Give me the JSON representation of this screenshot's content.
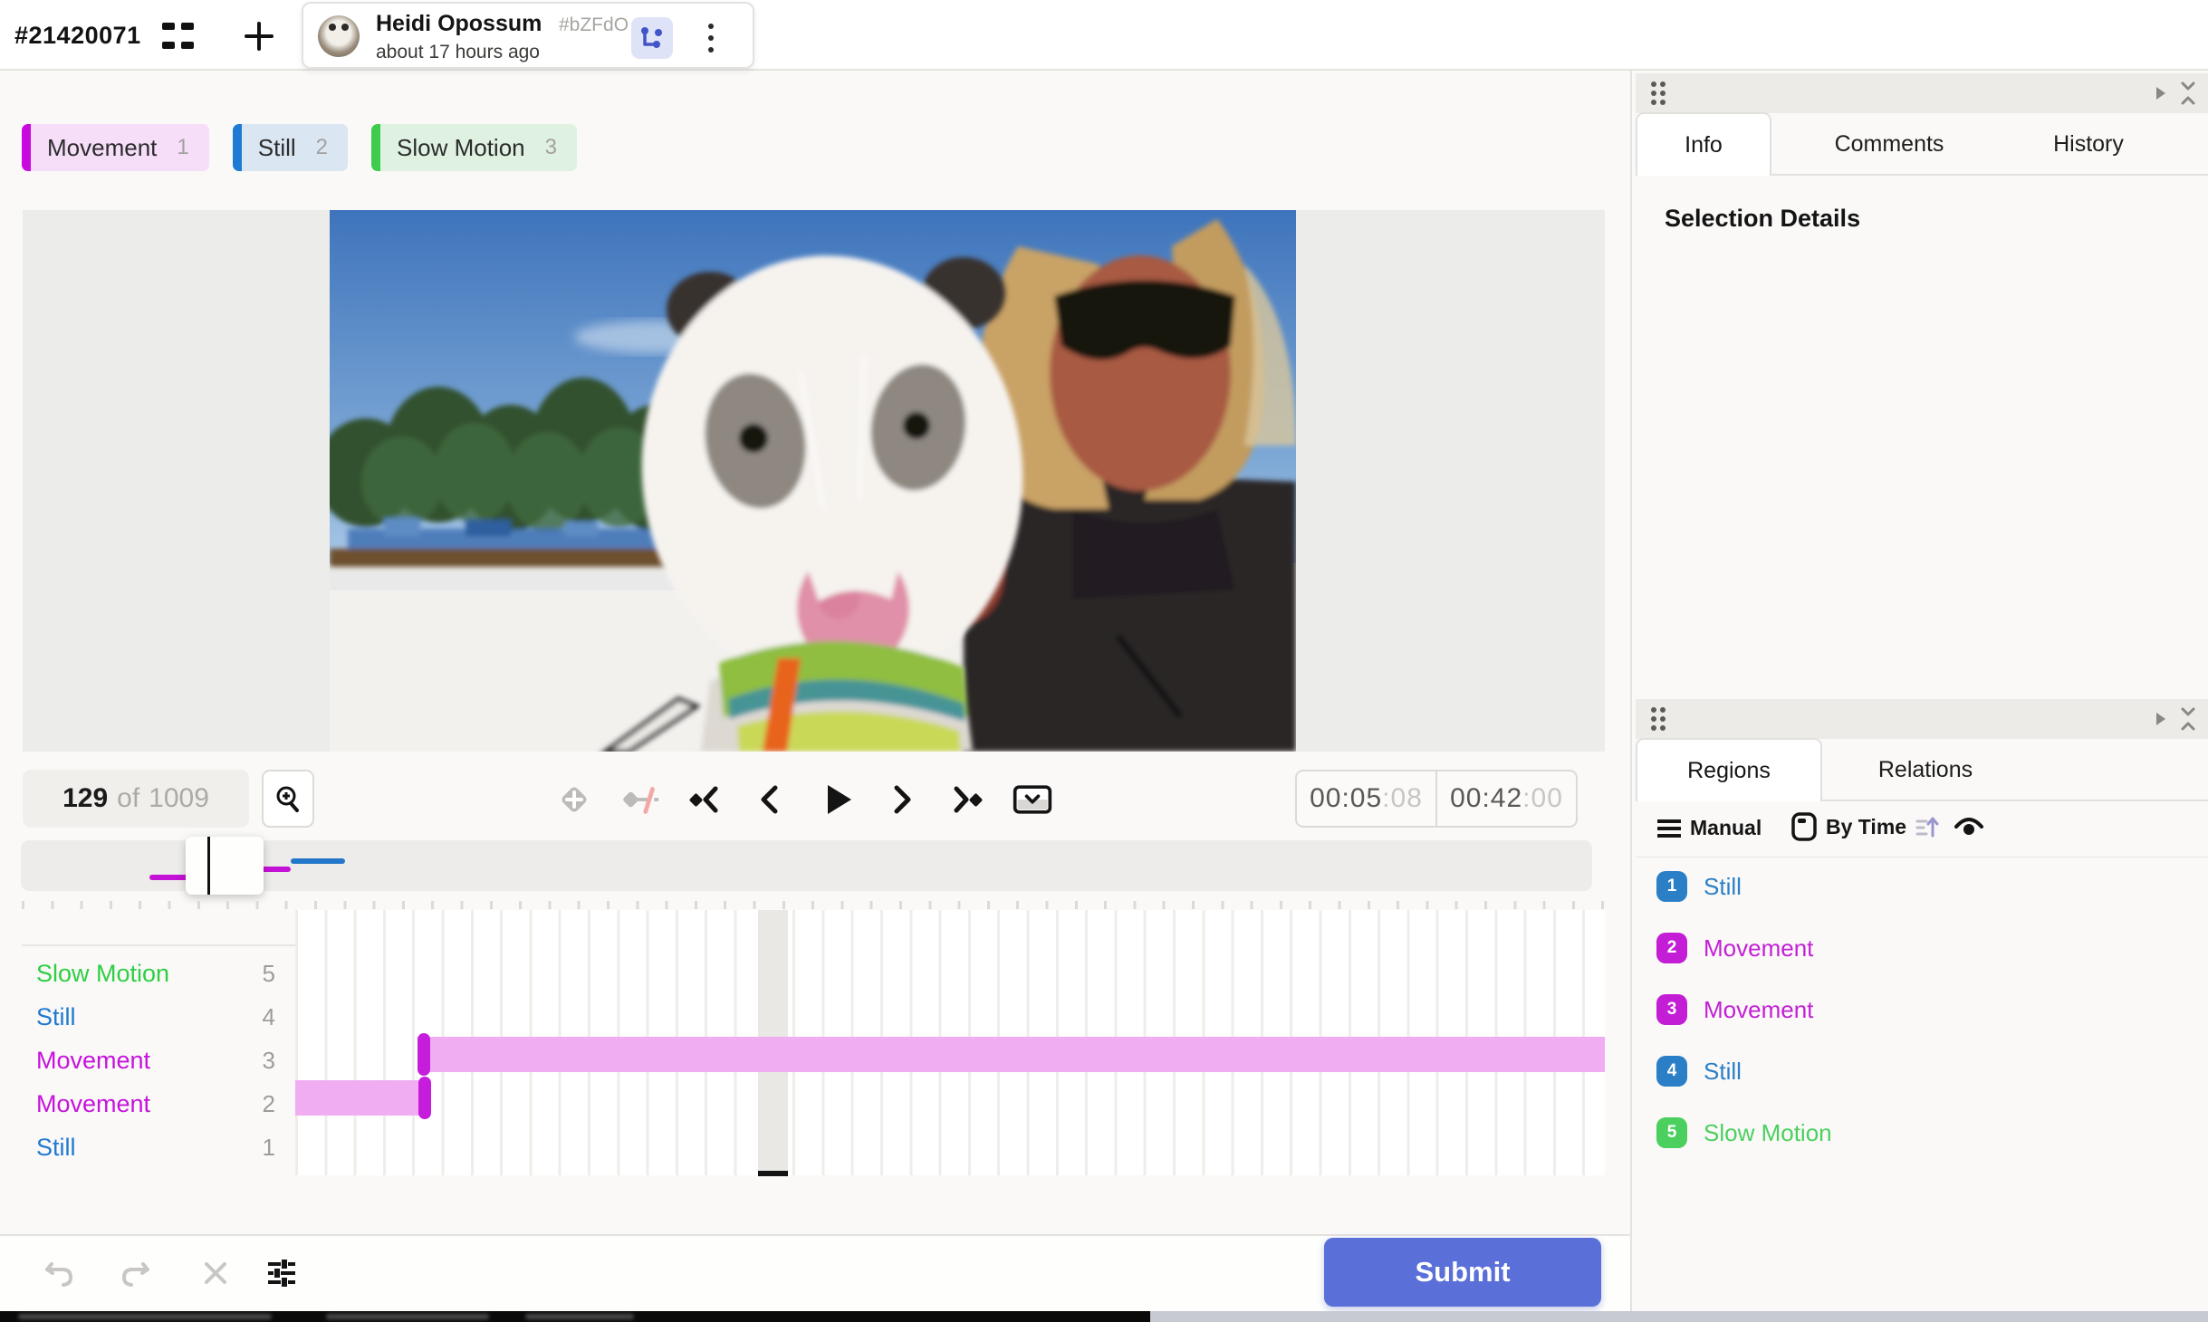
{
  "header": {
    "task_id": "#21420071",
    "annotation": {
      "user_name": "Heidi Opossum",
      "user_uid": "#bZFdO",
      "time": "about 17 hours ago"
    }
  },
  "labels": [
    {
      "name": "Movement",
      "hotkey": "1",
      "color": "#C80ADF",
      "bg": "#F6DEF8"
    },
    {
      "name": "Still",
      "hotkey": "2",
      "color": "#1F7AD4",
      "bg": "#DBE6F3"
    },
    {
      "name": "Slow Motion",
      "hotkey": "3",
      "color": "#3ECC4E",
      "bg": "#DFF2E1"
    }
  ],
  "player": {
    "frame_current": "129",
    "frame_of": "of",
    "frame_total": "1009",
    "time_current_main": "00:05",
    "time_current_sub": ":08",
    "time_total_main": "00:42",
    "time_total_sub": ":00",
    "control_icons": [
      "add-keyframe",
      "toggle-interpolation",
      "prev-keyframe",
      "prev-frame",
      "play",
      "next-frame",
      "next-keyframe",
      "toggle-timeline-panel"
    ]
  },
  "tracks": [
    {
      "name": "Slow Motion",
      "num": "5",
      "color": "#2FCE44"
    },
    {
      "name": "Still",
      "num": "4",
      "color": "#2079D3"
    },
    {
      "name": "Movement",
      "num": "3",
      "color": "#C613DD"
    },
    {
      "name": "Movement",
      "num": "2",
      "color": "#C613DD"
    },
    {
      "name": "Still",
      "num": "1",
      "color": "#2079D3"
    }
  ],
  "info_panel": {
    "tabs": {
      "info": "Info",
      "comments": "Comments",
      "history": "History"
    },
    "heading": "Selection Details"
  },
  "regions_panel": {
    "tabs": {
      "regions": "Regions",
      "relations": "Relations"
    },
    "group_manual": "Manual",
    "order_by_time": "By Time",
    "items": [
      {
        "num": "1",
        "label": "Still",
        "color": "#2B7FC7"
      },
      {
        "num": "2",
        "label": "Movement",
        "color": "#C31ED6"
      },
      {
        "num": "3",
        "label": "Movement",
        "color": "#C31ED6"
      },
      {
        "num": "4",
        "label": "Still",
        "color": "#2B7FC7"
      },
      {
        "num": "5",
        "label": "Slow Motion",
        "color": "#4BD05F"
      }
    ]
  },
  "footer": {
    "submit_label": "Submit"
  },
  "accent_colors": {
    "submit": "#5A6FD8",
    "timeline_bar": "#F0ADF2",
    "timeline_cap": "#C51DDB"
  }
}
